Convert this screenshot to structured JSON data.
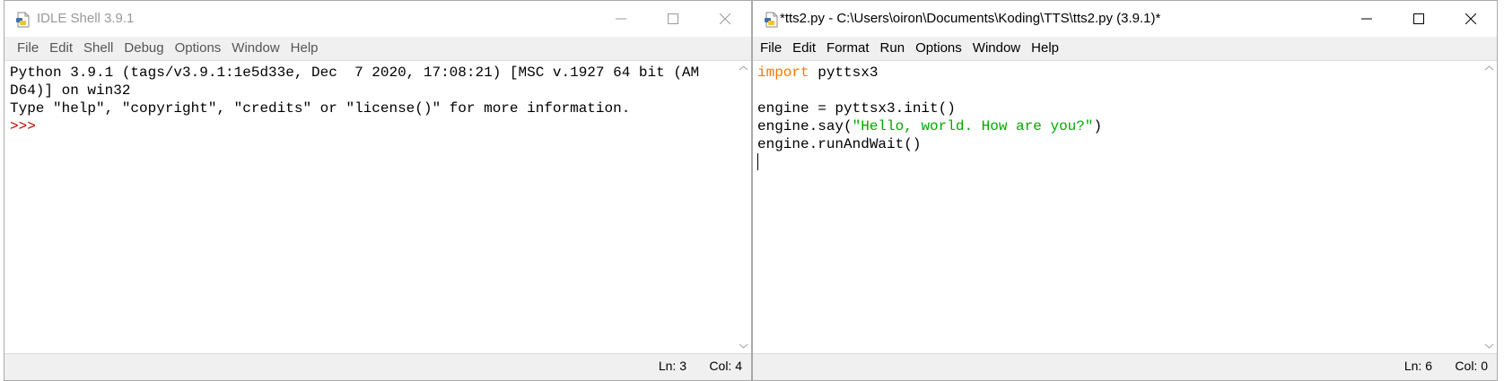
{
  "shell": {
    "title": "IDLE Shell 3.9.1",
    "menu": [
      "File",
      "Edit",
      "Shell",
      "Debug",
      "Options",
      "Window",
      "Help"
    ],
    "lines": [
      "Python 3.9.1 (tags/v3.9.1:1e5d33e, Dec  7 2020, 17:08:21) [MSC v.1927 64 bit (AM",
      "D64)] on win32",
      "Type \"help\", \"copyright\", \"credits\" or \"license()\" for more information."
    ],
    "prompt": ">>>",
    "status_ln": "Ln: 3",
    "status_col": "Col: 4"
  },
  "editor": {
    "title": "*tts2.py - C:\\Users\\oiron\\Documents\\Koding\\TTS\\tts2.py (3.9.1)*",
    "menu": [
      "File",
      "Edit",
      "Format",
      "Run",
      "Options",
      "Window",
      "Help"
    ],
    "code": {
      "line1_keyword": "import",
      "line1_rest": " pyttsx3",
      "line2": "",
      "line3": "engine = pyttsx3.init()",
      "line4_pre": "engine.say(",
      "line4_string": "\"Hello, world. How are you?\"",
      "line4_post": ")",
      "line5": "engine.runAndWait()"
    },
    "status_ln": "Ln: 6",
    "status_col": "Col: 0"
  },
  "icons": [
    "python-file-icon",
    "minimize-icon",
    "maximize-icon",
    "close-icon",
    "scroll-up-arrow-icon",
    "scroll-down-arrow-icon"
  ],
  "colors": {
    "keyword": "#ff7700",
    "string": "#00aa00",
    "prompt": "#c00000",
    "inactive_title": "#999999"
  }
}
